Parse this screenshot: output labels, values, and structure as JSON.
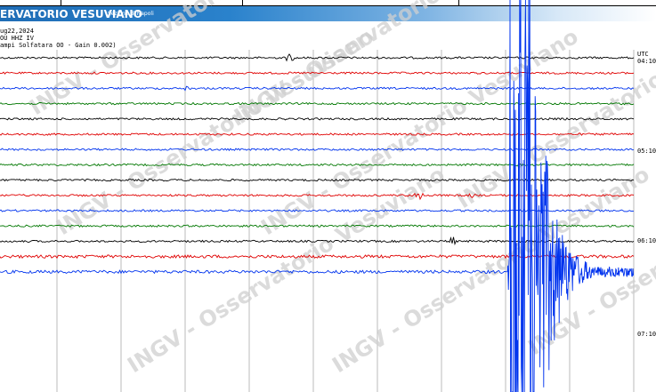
{
  "banner": {
    "title": "ERVATORIO VESUVIANO",
    "subtitle": "Sezione di Napoli"
  },
  "header": {
    "date": "ug22,2024",
    "channel": "OU HHZ IV",
    "station": "ampi Solfatara OO - Gain 0.002)"
  },
  "time_axis": {
    "utc_label": "UTC",
    "labels": [
      "04:10",
      "05:10",
      "06:10",
      "07:10"
    ]
  },
  "watermark": {
    "text": "INGV - Osservatorio Vesuviano"
  },
  "colors": {
    "trace_cycle": [
      "#000000",
      "#e00000",
      "#0033ee",
      "#007700"
    ],
    "banner": "#2a82cc",
    "grid": "#bbbbbb"
  }
}
